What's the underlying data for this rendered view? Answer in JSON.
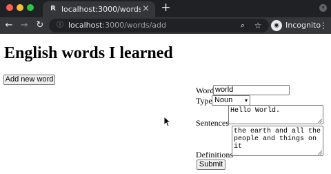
{
  "browser": {
    "tab": {
      "favicon": "R",
      "title": "localhost:3000/words/add",
      "close": "×"
    },
    "new_tab": "+",
    "tab_search": "▾",
    "nav": {
      "back": "←",
      "forward": "→",
      "reload": "↻"
    },
    "url": {
      "host": "localhost",
      "path": ":3000/words/add"
    },
    "zoom_icon": "⌕",
    "star_icon": "☆",
    "incognito": {
      "avatar": "◉",
      "label": "Incognito"
    },
    "menu_icon": "⋮",
    "lock_icon": "ⓘ"
  },
  "page": {
    "title": "English words I learned",
    "add_button": "Add new word",
    "form": {
      "word_label": "Word",
      "word_value": "world",
      "type_label": "Type",
      "type_value": "Noun",
      "type_chevron": "▾",
      "sentences_label": "Sentences",
      "sentences_value": "Hello World.",
      "definitions_label": "Definitions",
      "definitions_value": "the earth and all the people and things on it",
      "submit_label": "Submit"
    }
  },
  "colors": {
    "chrome_dark": "#202124",
    "chrome_mid": "#35363a",
    "chrome_text": "#e8eaed",
    "control_border": "#767676",
    "button_face": "#efefef"
  }
}
